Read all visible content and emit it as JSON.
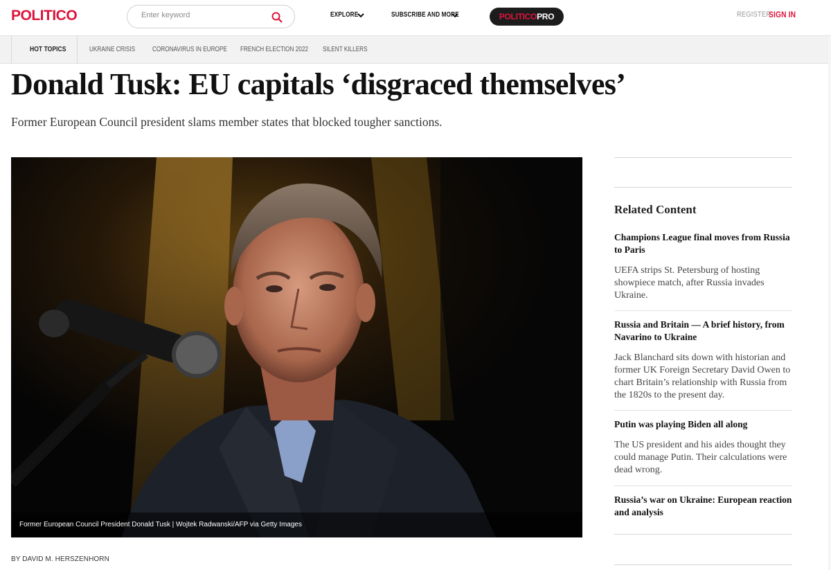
{
  "header": {
    "logo": "POLITICO",
    "search_placeholder": "Enter keyword",
    "nav": [
      {
        "label": "EXPLORE"
      },
      {
        "label": "SUBSCRIBE AND MORE"
      }
    ],
    "pro_part1": "POLITICO",
    "pro_part2": "PRO",
    "register": "REGISTER",
    "signin": "SIGN IN"
  },
  "topics": {
    "hot_label": "HOT TOPICS",
    "items": [
      "UKRAINE CRISIS",
      "CORONAVIRUS IN EUROPE",
      "FRENCH ELECTION 2022",
      "SILENT KILLERS"
    ]
  },
  "article": {
    "headline": "Donald Tusk: EU capitals ‘disgraced themselves’",
    "dek": "Former European Council president slams member states that blocked tougher sanctions.",
    "photo_caption": "Former European Council President Donald Tusk | Wojtek Radwanski/AFP via Getty Images",
    "byline": "BY DAVID M. HERSZENHORN"
  },
  "sidebar": {
    "title": "Related Content",
    "items": [
      {
        "headline": "Champions League final moves from Russia to Paris",
        "summary": "UEFA strips St. Petersburg of hosting showpiece match, after Russia invades Ukraine."
      },
      {
        "headline": "Russia and Britain — A brief history, from Navarino to Ukraine",
        "summary": "Jack Blanchard sits down with historian and former UK Foreign Secretary David Owen to chart Britain’s relationship with Russia from the 1820s to the present day."
      },
      {
        "headline": "Putin was playing Biden all along",
        "summary": "The US president and his aides thought they could manage Putin. Their calculations were dead wrong."
      },
      {
        "headline": "Russia’s war on Ukraine: European reaction and analysis",
        "summary": ""
      }
    ]
  },
  "colors": {
    "brand_red": "#dc143c",
    "pro_button_bg": "#1c1c1c"
  },
  "icons": [
    "search-icon",
    "chevron-down-icon"
  ]
}
